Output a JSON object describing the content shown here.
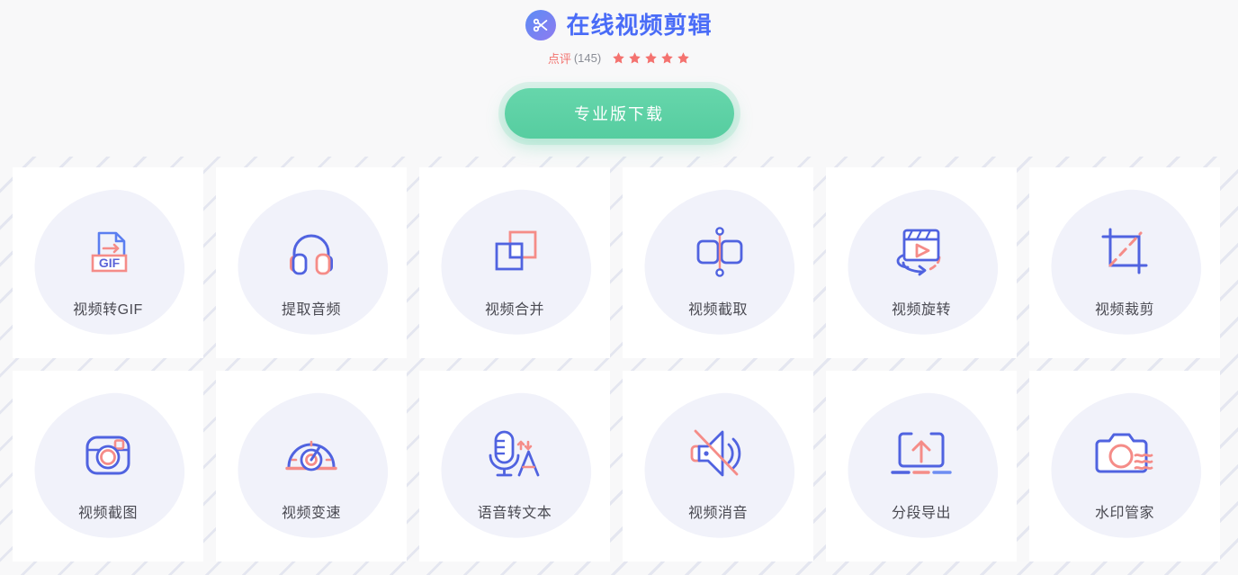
{
  "header": {
    "logo_icon": "scissors-icon",
    "title": "在线视频剪辑",
    "rating_label": "点评",
    "rating_count": "(145)",
    "stars_filled": 5,
    "cta_label": "专业版下载",
    "title_color": "#4a6cf7",
    "accent_pink": "#f2736f",
    "cta_color": "#59cfa3"
  },
  "tools": [
    {
      "label": "视频转GIF",
      "icon": "video-to-gif-icon"
    },
    {
      "label": "提取音频",
      "icon": "headphones-icon"
    },
    {
      "label": "视频合并",
      "icon": "merge-squares-icon"
    },
    {
      "label": "视频截取",
      "icon": "split-clip-icon"
    },
    {
      "label": "视频旋转",
      "icon": "clapperboard-rotate-icon"
    },
    {
      "label": "视频裁剪",
      "icon": "crop-frame-icon"
    },
    {
      "label": "视频截图",
      "icon": "camera-icon"
    },
    {
      "label": "视频变速",
      "icon": "speedometer-icon"
    },
    {
      "label": "语音转文本",
      "icon": "microphone-text-icon"
    },
    {
      "label": "视频消音",
      "icon": "speaker-mute-icon"
    },
    {
      "label": "分段导出",
      "icon": "export-upload-icon"
    },
    {
      "label": "水印管家",
      "icon": "watermark-camera-icon"
    }
  ],
  "palette": {
    "blue": "#5063e0",
    "blue_light": "#5b7ef0",
    "pink": "#f58c88",
    "pink_deep": "#f2736f",
    "blob": "#f1f2fa",
    "page_bg": "#f8f8f9",
    "card_bg": "#ffffff",
    "label_color": "#4a4a52"
  }
}
